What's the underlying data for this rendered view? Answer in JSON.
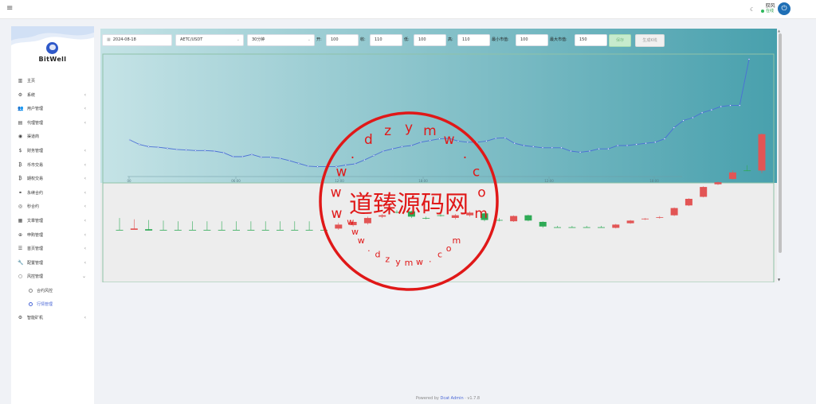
{
  "topbar": {
    "menu_icon": "menu-icon",
    "theme_icon": "moon-icon",
    "user_name": "ㅤ驭风",
    "user_status": "在线",
    "power_icon": "power-icon"
  },
  "sidebar": {
    "brand": "BitWell",
    "items": [
      {
        "icon": "bar-chart-icon",
        "glyph": "▥",
        "label": "主页",
        "chevron": false
      },
      {
        "icon": "gear-icon",
        "glyph": "⚙",
        "label": "系统",
        "chevron": true
      },
      {
        "icon": "user-group-icon",
        "glyph": "👥",
        "label": "用户管理",
        "chevron": true
      },
      {
        "icon": "id-card-icon",
        "glyph": "▤",
        "label": "代理管理",
        "chevron": true
      },
      {
        "icon": "user-circle-icon",
        "glyph": "◉",
        "label": "渠道商",
        "chevron": false
      },
      {
        "icon": "dollar-icon",
        "glyph": "$",
        "label": "财务管理",
        "chevron": true
      },
      {
        "icon": "bitcoin-icon",
        "glyph": "₿",
        "label": "币市交易",
        "chevron": true
      },
      {
        "icon": "bitcoin-small-icon",
        "glyph": "₿",
        "label": "期权交易",
        "chevron": true
      },
      {
        "icon": "link-icon",
        "glyph": "⚭",
        "label": "永续合约",
        "chevron": true
      },
      {
        "icon": "target-icon",
        "glyph": "◎",
        "label": "秒合约",
        "chevron": true
      },
      {
        "icon": "article-icon",
        "glyph": "▦",
        "label": "文章管理",
        "chevron": true
      },
      {
        "icon": "globe-icon",
        "glyph": "⊕",
        "label": "申购管理",
        "chevron": true
      },
      {
        "icon": "list-icon",
        "glyph": "☰",
        "label": "首页管理",
        "chevron": true
      },
      {
        "icon": "wrench-icon",
        "glyph": "🔧",
        "label": "配置管理",
        "chevron": true
      },
      {
        "icon": "circle-icon",
        "glyph": "○",
        "label": "风控管理",
        "chevron": true,
        "expanded": true
      }
    ],
    "subitems": [
      {
        "label": "合约风控",
        "active": false
      },
      {
        "label": "行情管理",
        "active": true
      }
    ],
    "last_item": {
      "icon": "robot-icon",
      "glyph": "⚙",
      "label": "智能矿机",
      "chevron": true
    }
  },
  "form": {
    "date_icon": "calendar-icon",
    "date": "2024-08-18",
    "symbol": "AETC/USDT",
    "interval": "30分钟",
    "open_label": "开:",
    "open": "100",
    "close_label": "收:",
    "close": "110",
    "low_label": "低:",
    "low": "100",
    "high_label": "高:",
    "high": "110",
    "min_label": "最小市值:",
    "min": "100",
    "max_label": "最大市值:",
    "max": "150",
    "save_label": "保存",
    "generate_label": "生成K线"
  },
  "colors": {
    "line": "#4a6fd6",
    "up": "#e25555",
    "down": "#2eaa55",
    "teal_start": "#c5e3e6",
    "teal_end": "#48a0ad"
  },
  "chart_data": [
    {
      "type": "line",
      "x_labels": [
        "00",
        "06:00",
        "12:00",
        "18:00",
        "12:00",
        "18:00"
      ],
      "values": [
        60,
        52,
        48,
        47,
        45,
        43,
        42,
        41,
        41,
        40,
        37,
        30,
        30,
        34,
        29,
        29,
        27,
        23,
        18,
        13,
        12,
        12,
        12,
        15,
        17,
        24,
        32,
        40,
        44,
        48,
        50,
        56,
        59,
        62,
        63,
        58,
        56,
        56,
        58,
        63,
        64,
        54,
        50,
        48,
        46,
        46,
        46,
        40,
        38,
        40,
        44,
        44,
        50,
        50,
        52,
        54,
        56,
        62,
        82,
        95,
        100,
        109,
        114,
        120,
        122,
        122,
        205
      ]
    },
    {
      "type": "bar",
      "series_name": "candles",
      "candles": [
        {
          "o": 100,
          "c": 100,
          "h": 118,
          "l": 100
        },
        {
          "o": 100,
          "c": 102,
          "h": 116,
          "l": 100
        },
        {
          "o": 101,
          "c": 99,
          "h": 115,
          "l": 99
        },
        {
          "o": 100,
          "c": 100,
          "h": 114,
          "l": 100
        },
        {
          "o": 100,
          "c": 100,
          "h": 113,
          "l": 100
        },
        {
          "o": 100,
          "c": 100,
          "h": 113,
          "l": 100
        },
        {
          "o": 100,
          "c": 100,
          "h": 113,
          "l": 100
        },
        {
          "o": 100,
          "c": 100,
          "h": 113,
          "l": 100
        },
        {
          "o": 100,
          "c": 100,
          "h": 113,
          "l": 100
        },
        {
          "o": 100,
          "c": 100,
          "h": 113,
          "l": 100
        },
        {
          "o": 100,
          "c": 100,
          "h": 113,
          "l": 100
        },
        {
          "o": 100,
          "c": 100,
          "h": 113,
          "l": 100
        },
        {
          "o": 100,
          "c": 100,
          "h": 113,
          "l": 100
        },
        {
          "o": 100,
          "c": 100,
          "h": 113,
          "l": 100
        },
        {
          "o": 100,
          "c": 100,
          "h": 113,
          "l": 100
        },
        {
          "o": 102,
          "c": 108,
          "h": 111,
          "l": 100
        },
        {
          "o": 107,
          "c": 112,
          "h": 115,
          "l": 105
        },
        {
          "o": 110,
          "c": 118,
          "h": 120,
          "l": 108
        },
        {
          "o": 120,
          "c": 122,
          "h": 124,
          "l": 118
        },
        {
          "o": 127,
          "c": 127,
          "h": 130,
          "l": 125
        },
        {
          "o": 128,
          "c": 120,
          "h": 129,
          "l": 118
        },
        {
          "o": 118,
          "c": 118,
          "h": 120,
          "l": 116
        },
        {
          "o": 122,
          "c": 122,
          "h": 124,
          "l": 120
        },
        {
          "o": 118,
          "c": 122,
          "h": 124,
          "l": 116
        },
        {
          "o": 122,
          "c": 126,
          "h": 128,
          "l": 120
        },
        {
          "o": 125,
          "c": 115,
          "h": 126,
          "l": 113
        },
        {
          "o": 115,
          "c": 115,
          "h": 118,
          "l": 113
        },
        {
          "o": 113,
          "c": 121,
          "h": 122,
          "l": 112
        },
        {
          "o": 122,
          "c": 114,
          "h": 123,
          "l": 113
        },
        {
          "o": 112,
          "c": 105,
          "h": 113,
          "l": 103
        },
        {
          "o": 104,
          "c": 104,
          "h": 106,
          "l": 103
        },
        {
          "o": 104,
          "c": 104,
          "h": 106,
          "l": 103
        },
        {
          "o": 104,
          "c": 104,
          "h": 106,
          "l": 103
        },
        {
          "o": 104,
          "c": 104,
          "h": 106,
          "l": 103
        },
        {
          "o": 103,
          "c": 108,
          "h": 109,
          "l": 102
        },
        {
          "o": 110,
          "c": 114,
          "h": 115,
          "l": 109
        },
        {
          "o": 116,
          "c": 117,
          "h": 118,
          "l": 115
        },
        {
          "o": 118,
          "c": 119,
          "h": 121,
          "l": 117
        },
        {
          "o": 122,
          "c": 133,
          "h": 134,
          "l": 121
        },
        {
          "o": 137,
          "c": 147,
          "h": 148,
          "l": 136
        },
        {
          "o": 150,
          "c": 165,
          "h": 166,
          "l": 149
        },
        {
          "o": 169,
          "c": 172,
          "h": 173,
          "l": 168
        },
        {
          "o": 177,
          "c": 187,
          "h": 190,
          "l": 176
        },
        {
          "o": 190,
          "c": 190,
          "h": 198,
          "l": 189
        },
        {
          "o": 190,
          "c": 245,
          "h": 246,
          "l": 186
        }
      ]
    }
  ],
  "footer": {
    "prefix": "Powered by",
    "link": "Dcat Admin",
    "sep": "·",
    "version": "v1.7.8"
  },
  "stamp": {
    "url_text": "w w w . d z y m w . c o m",
    "name": "道臻源码网"
  }
}
